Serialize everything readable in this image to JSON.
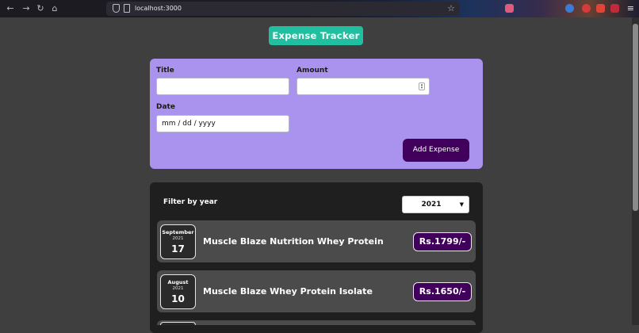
{
  "browser": {
    "url": "localhost:3000"
  },
  "app": {
    "title": "Expense Tracker"
  },
  "form": {
    "title_label": "Title",
    "title_value": "",
    "amount_label": "Amount",
    "amount_value": "",
    "date_label": "Date",
    "date_placeholder": "mm / dd / yyyy",
    "add_button": "Add Expense"
  },
  "filter": {
    "label": "Filter by year",
    "selected_year": "2021"
  },
  "expenses": [
    {
      "month": "September",
      "year": "2021",
      "day": "17",
      "title": "Muscle Blaze Nutrition Whey Protein",
      "amount": "Rs.1799/-"
    },
    {
      "month": "August",
      "year": "2021",
      "day": "10",
      "title": "Muscle Blaze Whey Protein Isolate",
      "amount": "Rs.1650/-"
    }
  ],
  "colors": {
    "accent": "#1fbf9f",
    "form_bg": "#a993ee",
    "button_bg": "#40005c",
    "list_bg": "#1f1f1f",
    "item_bg": "#4b4b4b",
    "page_bg": "#3f3f3f"
  },
  "icons": {
    "back": "arrow-left-icon",
    "forward": "arrow-right-icon",
    "reload": "reload-icon",
    "home": "home-icon",
    "shield": "shield-icon",
    "page": "page-icon",
    "bookmark": "star-icon",
    "menu": "hamburger-menu-icon",
    "select": "chevron-down-icon",
    "spinner": "number-spinner-icon"
  }
}
